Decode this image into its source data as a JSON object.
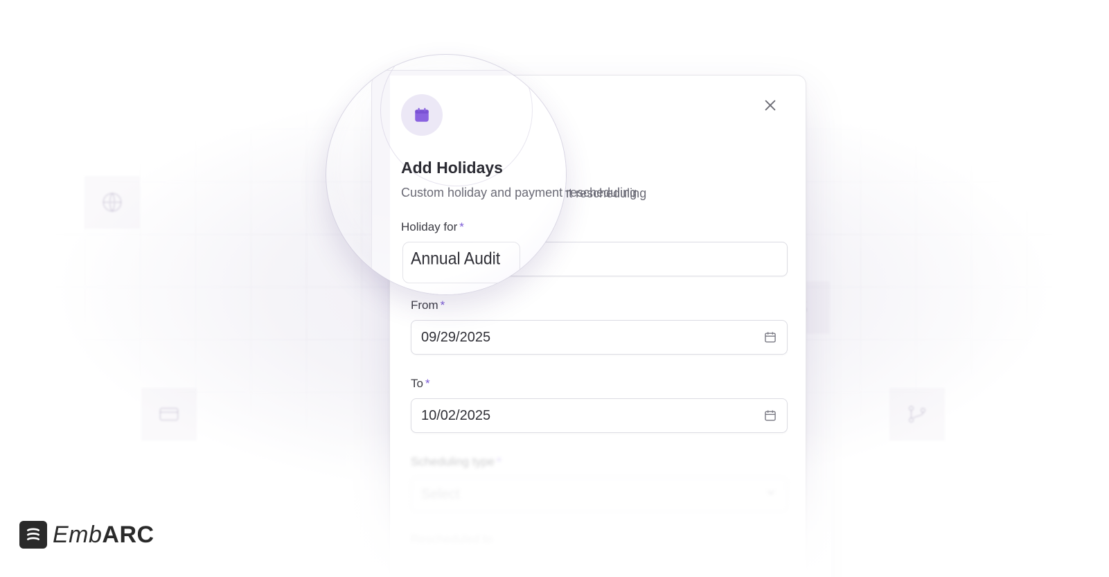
{
  "modal": {
    "title": "Add Holidays",
    "subtitle": "Custom holiday and payment rescheduling",
    "icon": "calendar-icon",
    "accent_color": "#8a63e0",
    "fields": {
      "holiday_for": {
        "label": "Holiday for",
        "required_mark": "*",
        "value": "Annual Audit"
      },
      "from": {
        "label": "From",
        "required_mark": "*",
        "value": "09/29/2025"
      },
      "to": {
        "label": "To",
        "required_mark": "*",
        "value": "10/02/2025"
      },
      "scheduling_type": {
        "label": "Scheduling type",
        "required_mark": "*",
        "value": "Select"
      },
      "rescheduled_to": {
        "label": "Rescheduled to"
      }
    }
  },
  "logo": {
    "light": "Emb",
    "bold": "ARC"
  }
}
